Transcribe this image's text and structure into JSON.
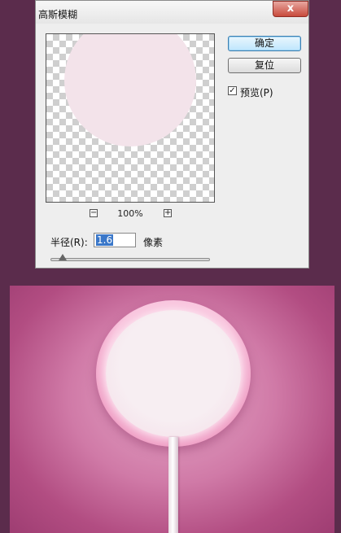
{
  "dialog": {
    "title": "高斯模糊",
    "close_glyph": "x",
    "ok_label": "确定",
    "reset_label": "复位",
    "preview_checkbox": {
      "label": "预览(P)",
      "checked": true,
      "glyph": "✓"
    },
    "zoom": {
      "minus": "−",
      "level": "100%",
      "plus": "+"
    },
    "radius": {
      "label": "半径(R):",
      "value": "1.6",
      "unit": "像素"
    }
  },
  "colors": {
    "background": "#5b2c4c",
    "artwork_pink": "#d07aa7",
    "candy": "#f7eef2",
    "ok_button": "#bee6fd",
    "close_button": "#c84a3c"
  }
}
